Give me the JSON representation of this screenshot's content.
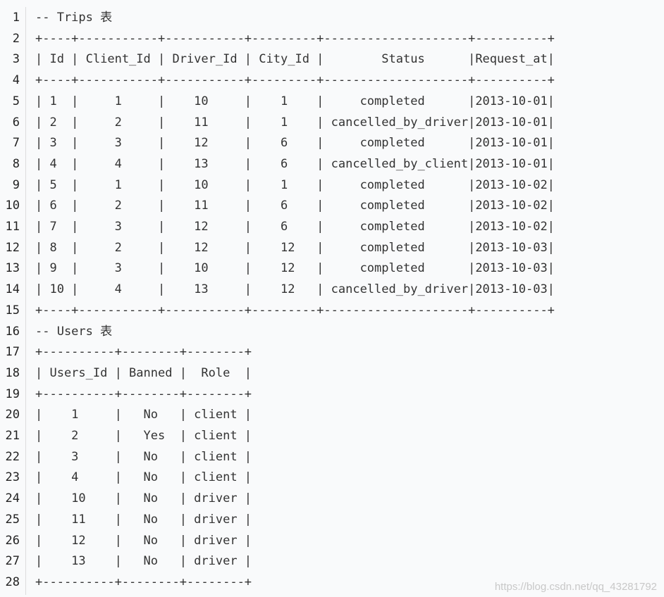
{
  "code": {
    "lines": [
      "-- Trips 表",
      "+----+-----------+-----------+---------+--------------------+----------+",
      "| Id | Client_Id | Driver_Id | City_Id |        Status      |Request_at|",
      "+----+-----------+-----------+---------+--------------------+----------+",
      "| 1  |     1     |    10     |    1    |     completed      |2013-10-01|",
      "| 2  |     2     |    11     |    1    | cancelled_by_driver|2013-10-01|",
      "| 3  |     3     |    12     |    6    |     completed      |2013-10-01|",
      "| 4  |     4     |    13     |    6    | cancelled_by_client|2013-10-01|",
      "| 5  |     1     |    10     |    1    |     completed      |2013-10-02|",
      "| 6  |     2     |    11     |    6    |     completed      |2013-10-02|",
      "| 7  |     3     |    12     |    6    |     completed      |2013-10-02|",
      "| 8  |     2     |    12     |    12   |     completed      |2013-10-03|",
      "| 9  |     3     |    10     |    12   |     completed      |2013-10-03|",
      "| 10 |     4     |    13     |    12   | cancelled_by_driver|2013-10-03|",
      "+----+-----------+-----------+---------+--------------------+----------+",
      "-- Users 表",
      "+----------+--------+--------+",
      "| Users_Id | Banned |  Role  |",
      "+----------+--------+--------+",
      "|    1     |   No   | client |",
      "|    2     |   Yes  | client |",
      "|    3     |   No   | client |",
      "|    4     |   No   | client |",
      "|    10    |   No   | driver |",
      "|    11    |   No   | driver |",
      "|    12    |   No   | driver |",
      "|    13    |   No   | driver |",
      "+----------+--------+--------+"
    ]
  },
  "watermark": "https://blog.csdn.net/qq_43281792",
  "colors": {
    "number_highlight": "#a57a1a",
    "text": "#333333",
    "background": "#f9fafb"
  }
}
